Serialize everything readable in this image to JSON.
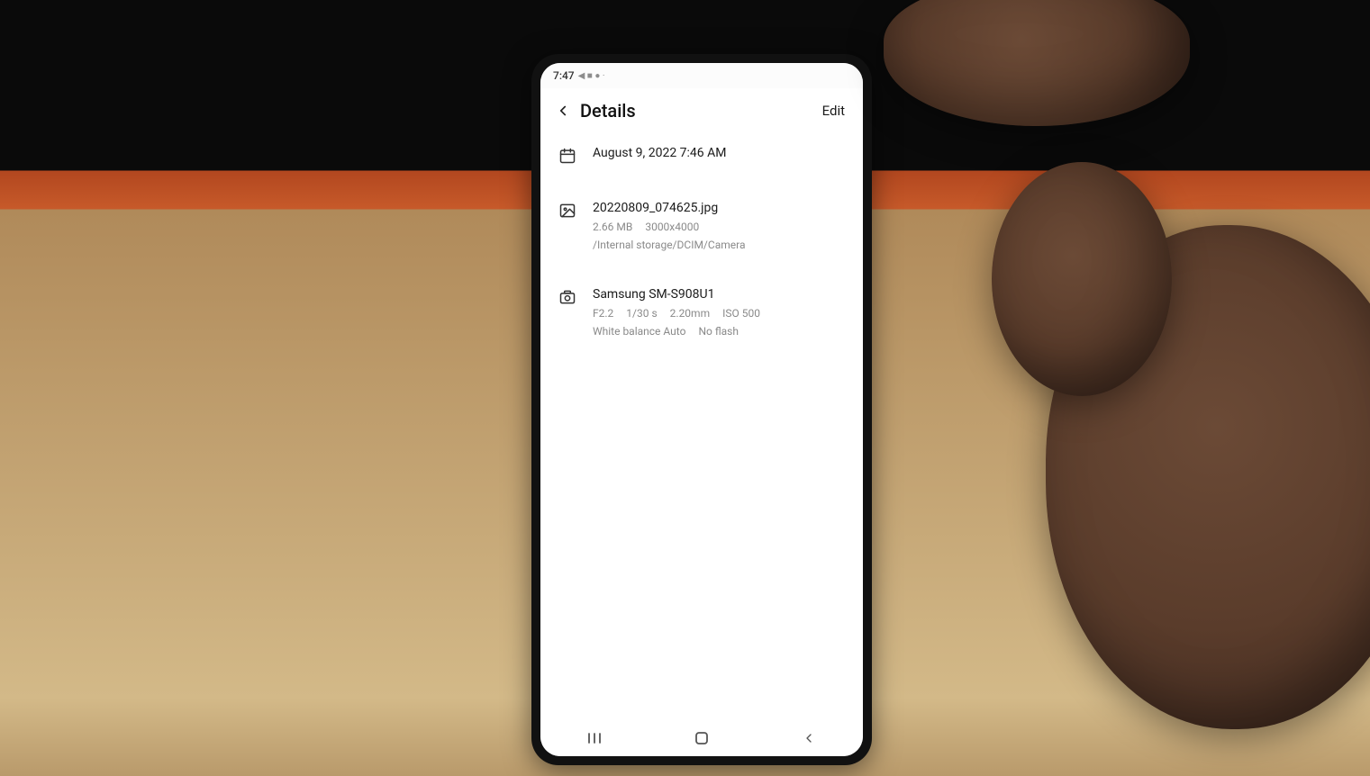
{
  "status": {
    "time": "7:47",
    "icons": "◀ ■ ● ·"
  },
  "header": {
    "title": "Details",
    "edit_label": "Edit"
  },
  "date": {
    "text": "August 9, 2022 7:46 AM"
  },
  "file": {
    "name": "20220809_074625.jpg",
    "size": "2.66 MB",
    "dimensions": "3000x4000",
    "path": "/Internal storage/DCIM/Camera"
  },
  "camera": {
    "device": "Samsung SM-S908U1",
    "aperture": "F2.2",
    "shutter": "1/30 s",
    "focal": "2.20mm",
    "iso": "ISO 500",
    "wb": "White balance Auto",
    "flash": "No flash"
  }
}
